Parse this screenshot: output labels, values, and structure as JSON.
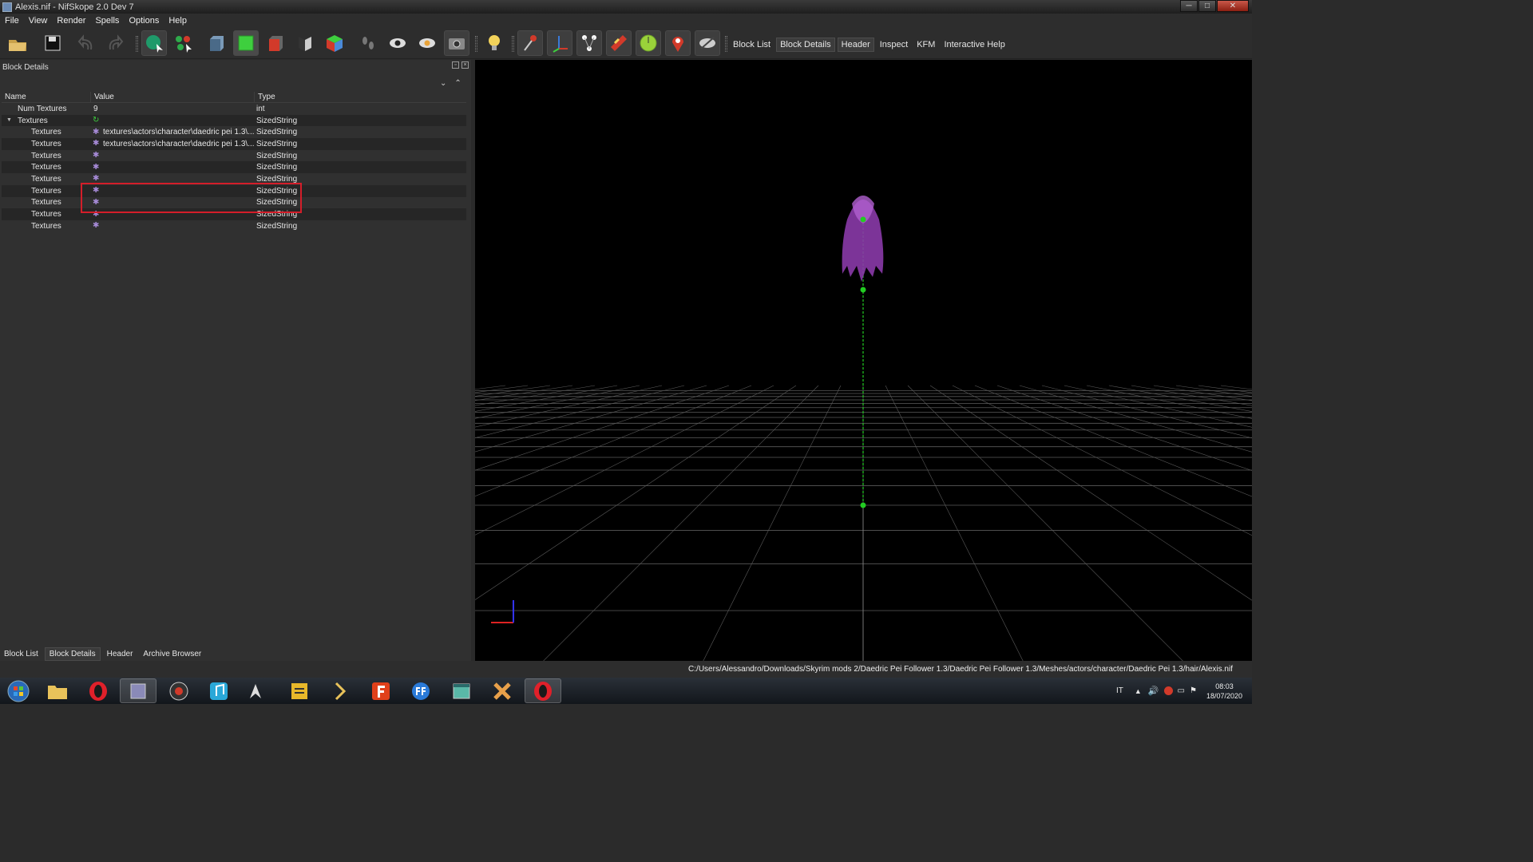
{
  "window": {
    "title": "Alexis.nif - NifSkope 2.0 Dev 7",
    "minimize": "─",
    "maximize": "□",
    "close": "✕"
  },
  "menu": [
    "File",
    "View",
    "Render",
    "Spells",
    "Options",
    "Help"
  ],
  "toolbar_links": [
    "Block List",
    "Block Details",
    "Header",
    "Inspect",
    "KFM",
    "Interactive Help"
  ],
  "panel": {
    "title": "Block Details",
    "columns": [
      "Name",
      "Value",
      "Type"
    ],
    "rows": [
      {
        "name": "Num Textures",
        "value": "9",
        "type": "int",
        "icon": "none",
        "indent": 1
      },
      {
        "name": "Textures",
        "value": "",
        "type": "SizedString",
        "icon": "refresh-icon",
        "indent": 0,
        "expanded": true
      },
      {
        "name": "Textures",
        "value": "textures\\actors\\character\\daedric pei 1.3\\...",
        "type": "SizedString",
        "icon": "gear-icon",
        "indent": 2
      },
      {
        "name": "Textures",
        "value": "textures\\actors\\character\\daedric pei 1.3\\...",
        "type": "SizedString",
        "icon": "gear-icon",
        "indent": 2
      },
      {
        "name": "Textures",
        "value": "",
        "type": "SizedString",
        "icon": "gear-icon",
        "indent": 2
      },
      {
        "name": "Textures",
        "value": "",
        "type": "SizedString",
        "icon": "gear-icon",
        "indent": 2
      },
      {
        "name": "Textures",
        "value": "",
        "type": "SizedString",
        "icon": "gear-icon",
        "indent": 2
      },
      {
        "name": "Textures",
        "value": "",
        "type": "SizedString",
        "icon": "gear-icon",
        "indent": 2
      },
      {
        "name": "Textures",
        "value": "",
        "type": "SizedString",
        "icon": "gear-icon",
        "indent": 2
      },
      {
        "name": "Textures",
        "value": "",
        "type": "SizedString",
        "icon": "gear-icon",
        "indent": 2
      },
      {
        "name": "Textures",
        "value": "",
        "type": "SizedString",
        "icon": "gear-icon",
        "indent": 2
      }
    ]
  },
  "bottom_tabs": [
    "Block List",
    "Block Details",
    "Header",
    "Archive Browser"
  ],
  "status": {
    "path": "C:/Users/Alessandro/Downloads/Skyrim mods 2/Daedric Pei Follower 1.3/Daedric Pei Follower 1.3/Meshes/actors/character/Daedric Pei 1.3/hair/Alexis.nif"
  },
  "taskbar": {
    "lang": "IT",
    "time": "08:03",
    "date": "18/07/2020"
  },
  "colors": {
    "highlight": "#d41e2a",
    "bone": "#22cc22",
    "hair": "#8a3aa8",
    "grid": "#5a5a5a"
  }
}
